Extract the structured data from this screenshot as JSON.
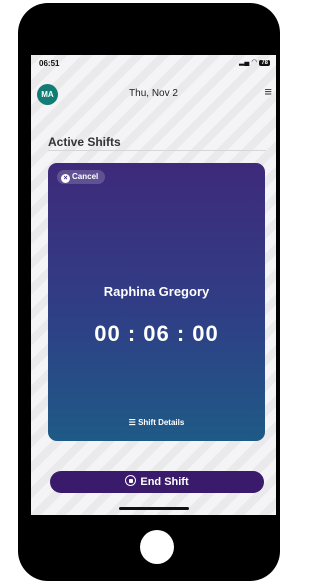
{
  "status_bar": {
    "time": "06:51",
    "battery": "78"
  },
  "header": {
    "avatar_initials": "MA",
    "date": "Thu, Nov 2"
  },
  "section_title": "Active Shifts",
  "card": {
    "cancel_label": "Cancel",
    "name": "Raphina Gregory",
    "timer": "00 : 06 : 00",
    "details_label": "Shift Details"
  },
  "end_shift_label": "End Shift",
  "colors": {
    "avatar": "#127d74",
    "card_top": "#3e2a7a",
    "card_bottom": "#1e5a86",
    "end_button": "#3a1a6a"
  }
}
